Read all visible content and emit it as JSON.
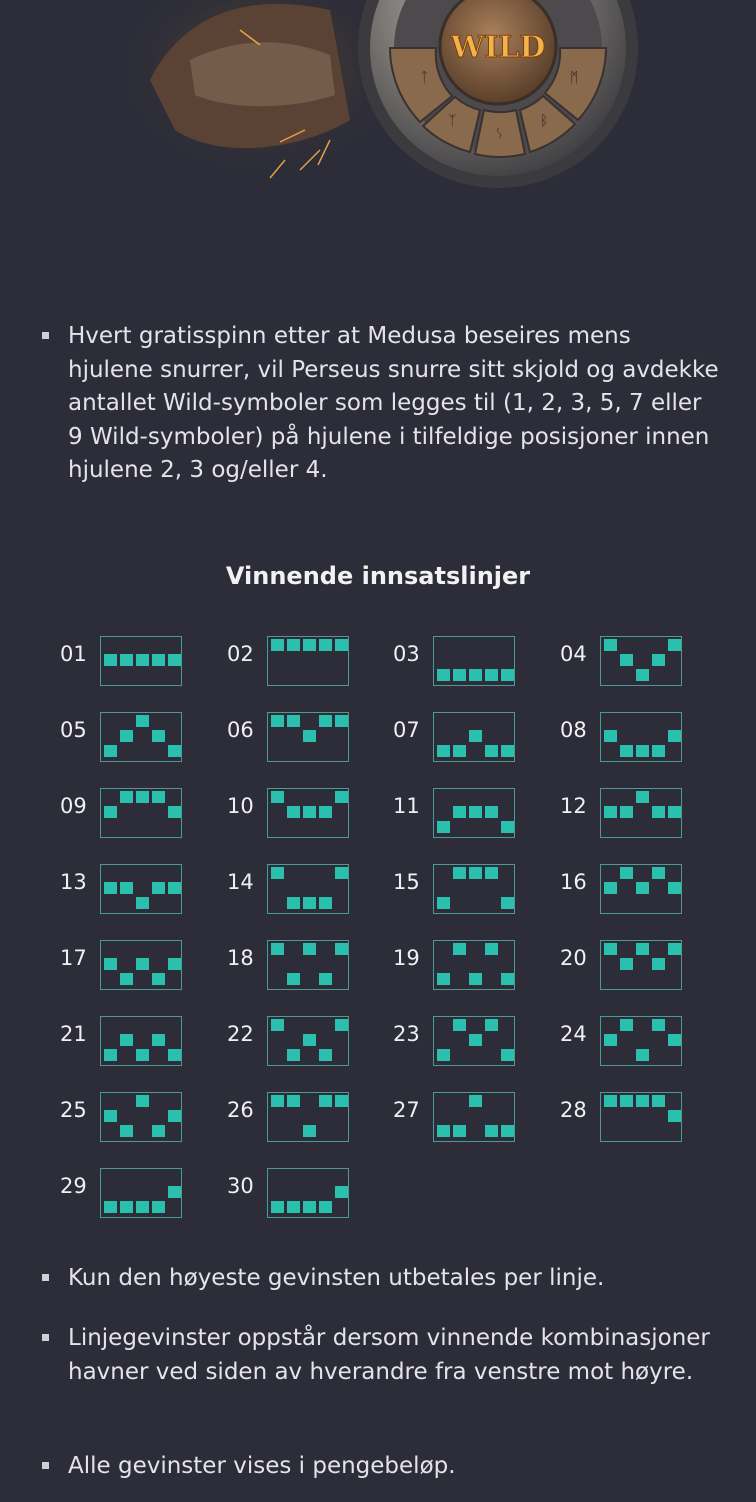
{
  "hero": {
    "wild_label": "WILD"
  },
  "bullets_top": [
    "Hvert gratisspinn etter at Medusa beseires mens hjulene snurrer, vil Perseus snurre sitt skjold og avdekke antallet Wild-symboler som legges til (1, 2, 3, 5, 7 eller 9 Wild-symboler) på hjulene i tilfeldige posisjoner innen hjulene 2, 3 og/eller 4."
  ],
  "section_title": "Vinnende innsatslinjer",
  "paylines": [
    {
      "label": "01",
      "rows": [
        1,
        1,
        1,
        1,
        1
      ]
    },
    {
      "label": "02",
      "rows": [
        0,
        0,
        0,
        0,
        0
      ]
    },
    {
      "label": "03",
      "rows": [
        2,
        2,
        2,
        2,
        2
      ]
    },
    {
      "label": "04",
      "rows": [
        0,
        1,
        2,
        1,
        0
      ]
    },
    {
      "label": "05",
      "rows": [
        2,
        1,
        0,
        1,
        2
      ]
    },
    {
      "label": "06",
      "rows": [
        0,
        0,
        1,
        0,
        0
      ]
    },
    {
      "label": "07",
      "rows": [
        2,
        2,
        1,
        2,
        2
      ]
    },
    {
      "label": "08",
      "rows": [
        1,
        2,
        2,
        2,
        1
      ]
    },
    {
      "label": "09",
      "rows": [
        1,
        0,
        0,
        0,
        1
      ]
    },
    {
      "label": "10",
      "rows": [
        0,
        1,
        1,
        1,
        0
      ]
    },
    {
      "label": "11",
      "rows": [
        2,
        1,
        1,
        1,
        2
      ]
    },
    {
      "label": "12",
      "rows": [
        1,
        1,
        0,
        1,
        1
      ]
    },
    {
      "label": "13",
      "rows": [
        1,
        1,
        2,
        1,
        1
      ]
    },
    {
      "label": "14",
      "rows": [
        0,
        2,
        2,
        2,
        0
      ]
    },
    {
      "label": "15",
      "rows": [
        2,
        0,
        0,
        0,
        2
      ]
    },
    {
      "label": "16",
      "rows": [
        1,
        0,
        1,
        0,
        1
      ]
    },
    {
      "label": "17",
      "rows": [
        1,
        2,
        1,
        2,
        1
      ]
    },
    {
      "label": "18",
      "rows": [
        0,
        2,
        0,
        2,
        0
      ]
    },
    {
      "label": "19",
      "rows": [
        2,
        0,
        2,
        0,
        2
      ]
    },
    {
      "label": "20",
      "rows": [
        0,
        1,
        0,
        1,
        0
      ]
    },
    {
      "label": "21",
      "rows": [
        2,
        1,
        2,
        1,
        2
      ]
    },
    {
      "label": "22",
      "rows": [
        0,
        2,
        1,
        2,
        0
      ]
    },
    {
      "label": "23",
      "rows": [
        2,
        0,
        1,
        0,
        2
      ]
    },
    {
      "label": "24",
      "rows": [
        1,
        0,
        2,
        0,
        1
      ]
    },
    {
      "label": "25",
      "rows": [
        1,
        2,
        0,
        2,
        1
      ]
    },
    {
      "label": "26",
      "rows": [
        0,
        0,
        2,
        0,
        0
      ]
    },
    {
      "label": "27",
      "rows": [
        2,
        2,
        0,
        2,
        2
      ]
    },
    {
      "label": "28",
      "rows": [
        0,
        0,
        0,
        0,
        1
      ]
    },
    {
      "label": "29",
      "rows": [
        2,
        2,
        2,
        2,
        1
      ]
    },
    {
      "label": "30",
      "rows": [
        2,
        2,
        2,
        2,
        1
      ]
    }
  ],
  "bullets_bottom": [
    "Kun den høyeste gevinsten utbetales per linje.",
    "Linjegevinster oppstår dersom vinnende kombinasjoner havner ved siden av hverandre fra venstre mot høyre.",
    "Alle gevinster vises i pengebeløp."
  ],
  "colors": {
    "background": "#2c2d38",
    "payline_cell": "#2bbfae",
    "payline_border": "#4c9a96"
  }
}
